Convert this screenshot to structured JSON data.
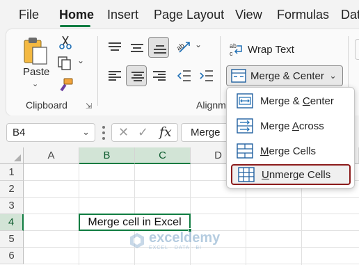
{
  "tabs": [
    "File",
    "Home",
    "Insert",
    "Page Layout",
    "View",
    "Formulas",
    "Dat"
  ],
  "active_tab": "Home",
  "ribbon": {
    "clipboard": {
      "paste_label": "Paste",
      "group_label": "Clipboard"
    },
    "alignment": {
      "group_label": "Alignme",
      "wrap_text": "Wrap Text",
      "merge_center": "Merge & Center"
    }
  },
  "formula_bar": {
    "name_box": "B4",
    "formula_text": "Merge",
    "fx_symbol": "fx"
  },
  "sheet": {
    "columns": [
      "A",
      "B",
      "C",
      "D"
    ],
    "rows": [
      "1",
      "2",
      "3",
      "4",
      "5",
      "6"
    ],
    "selected_column": "B",
    "selected_row": "4",
    "active_cell_ref": "B4",
    "active_cell_value": "Merge cell in Excel"
  },
  "merge_menu": {
    "items": [
      {
        "label": "Merge & Center",
        "parts": [
          "Merge & ",
          "C",
          "enter"
        ],
        "highlighted": false
      },
      {
        "label": "Merge Across",
        "parts": [
          "Merge ",
          "A",
          "cross"
        ],
        "highlighted": false
      },
      {
        "label": "Merge Cells",
        "parts": [
          "",
          "M",
          "erge Cells"
        ],
        "highlighted": false
      },
      {
        "label": "Unmerge Cells",
        "parts": [
          "",
          "U",
          "nmerge Cells"
        ],
        "highlighted": true
      }
    ]
  },
  "watermark": {
    "title": "exceldemy",
    "subtitle": "EXCEL · DATA · BI"
  },
  "colors": {
    "accent_green": "#107c41",
    "header_selected": "#d2e4d6",
    "highlight_border": "#8b1a1a",
    "ribbon_bg": "#fafafa",
    "window_bg": "#f3f3f3",
    "gridline": "#e1e1e1"
  },
  "icons": [
    "paste-icon",
    "cut-icon",
    "copy-icon",
    "format-painter-icon",
    "dialog-launcher-icon",
    "align-top-icon",
    "align-middle-icon",
    "align-bottom-icon",
    "orientation-icon",
    "align-left-icon",
    "align-center-icon",
    "align-right-icon",
    "decrease-indent-icon",
    "increase-indent-icon",
    "wrap-text-icon",
    "merge-icon",
    "chevron-down-icon",
    "cancel-icon",
    "enter-icon",
    "insert-function-icon"
  ]
}
